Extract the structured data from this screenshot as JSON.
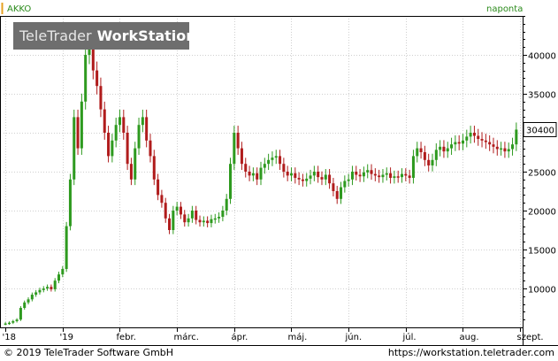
{
  "symbol": "AKKO",
  "frequency": "naponta",
  "watermark": {
    "brand": "TeleTrader",
    "product": "WorkStation"
  },
  "footer": {
    "copyright": "© 2019 TeleTrader Software GmbH",
    "url": "https://workstation.teletrader.com"
  },
  "colors": {
    "up": "#2e9a1f",
    "down": "#b01c1c",
    "axis": "#000000",
    "accent": "#2a8a1a"
  },
  "chart_data": {
    "type": "candlestick",
    "ylim": [
      5000,
      45000
    ],
    "yticks": [
      10000,
      15000,
      20000,
      25000,
      30000,
      35000,
      40000
    ],
    "current_value": "30400",
    "current": 30400,
    "x_labels": [
      {
        "label": "'18",
        "i": 0
      },
      {
        "label": "'19",
        "i": 15
      },
      {
        "label": "febr.",
        "i": 30
      },
      {
        "label": "márc.",
        "i": 45
      },
      {
        "label": "ápr.",
        "i": 60
      },
      {
        "label": "máj.",
        "i": 75
      },
      {
        "label": "jún.",
        "i": 90
      },
      {
        "label": "júl.",
        "i": 105
      },
      {
        "label": "aug.",
        "i": 120
      },
      {
        "label": "szept.",
        "i": 135
      }
    ],
    "close": [
      5500,
      5600,
      5800,
      6000,
      7500,
      8200,
      8600,
      9200,
      9500,
      9800,
      10000,
      10200,
      9900,
      11000,
      11800,
      12500,
      18000,
      24000,
      32000,
      28000,
      34000,
      40000,
      42000,
      38000,
      36000,
      33000,
      30000,
      27000,
      29000,
      31000,
      32000,
      30000,
      26000,
      24000,
      28000,
      31000,
      32000,
      29000,
      27000,
      24000,
      22000,
      21000,
      19000,
      17500,
      20000,
      20500,
      19500,
      18500,
      19000,
      20000,
      18800,
      18500,
      18700,
      18400,
      18900,
      19000,
      19200,
      20000,
      21500,
      26000,
      30000,
      28000,
      26000,
      25000,
      24500,
      24800,
      24000,
      25500,
      26000,
      26500,
      26800,
      27000,
      26000,
      25000,
      24500,
      24800,
      24200,
      24000,
      23800,
      24100,
      24500,
      25000,
      24300,
      24000,
      24600,
      23500,
      22500,
      21500,
      23000,
      23800,
      24000,
      25000,
      24600,
      24400,
      24900,
      25200,
      24700,
      24500,
      24300,
      24600,
      24800,
      24200,
      24400,
      24300,
      24700,
      24500,
      24200,
      27000,
      28000,
      27500,
      26500,
      25800,
      26500,
      27800,
      28200,
      27600,
      28000,
      28500,
      28800,
      28600,
      29000,
      29500,
      30000,
      29600,
      29200,
      29000,
      28800,
      28500,
      28200,
      27900,
      28000,
      27600,
      27900,
      28500,
      30400
    ]
  }
}
